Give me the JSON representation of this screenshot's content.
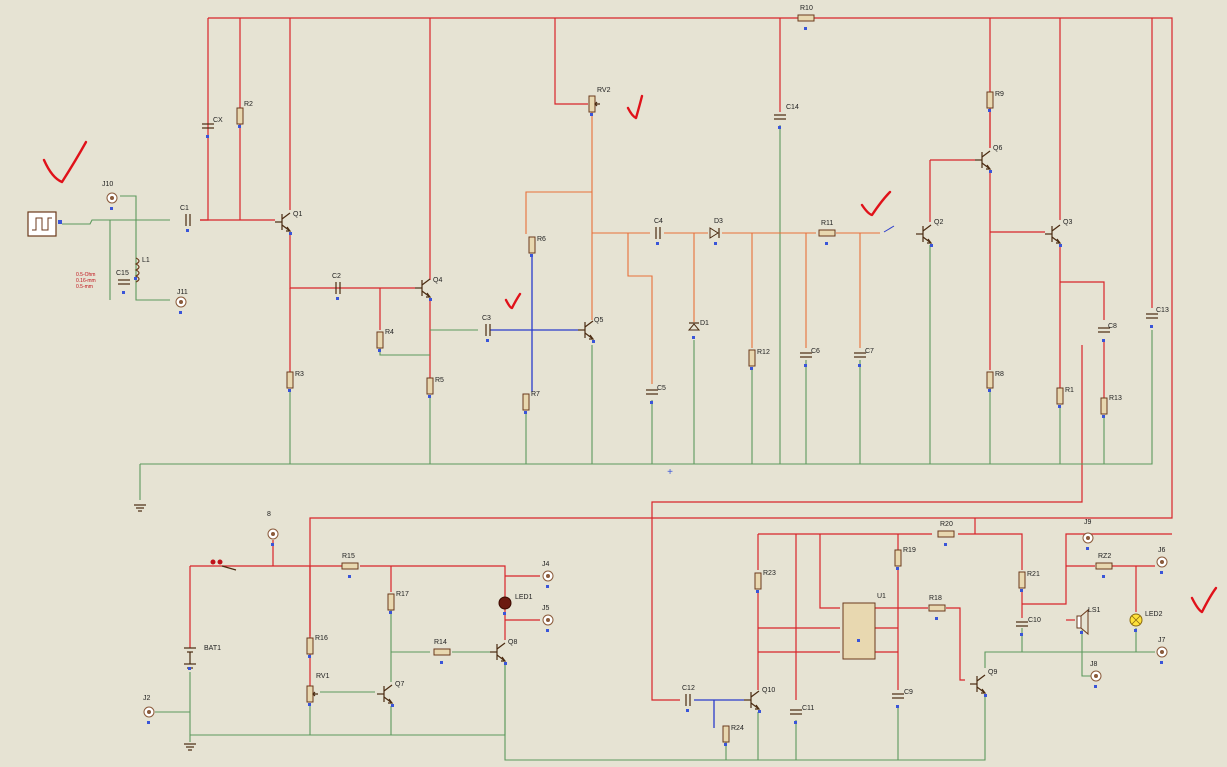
{
  "components": [
    {
      "id": "x1",
      "ref": "J10",
      "type": "pin"
    },
    {
      "id": "x2",
      "ref": "J11",
      "type": "pin"
    },
    {
      "id": "x3",
      "ref": "C1",
      "type": "cap"
    },
    {
      "id": "x4",
      "ref": "L1",
      "type": "ind"
    },
    {
      "id": "x5",
      "ref": "C15",
      "type": "cap"
    },
    {
      "id": "x6",
      "ref": "R2",
      "type": "res"
    },
    {
      "id": "x7",
      "ref": "CX",
      "type": "cap"
    },
    {
      "id": "x8",
      "ref": "Q1",
      "type": "npn"
    },
    {
      "id": "x9",
      "ref": "C2",
      "type": "cap"
    },
    {
      "id": "x10",
      "ref": "Q4",
      "type": "npn"
    },
    {
      "id": "x11",
      "ref": "R4",
      "type": "res"
    },
    {
      "id": "x12",
      "ref": "R3",
      "type": "res"
    },
    {
      "id": "x13",
      "ref": "R5",
      "type": "res"
    },
    {
      "id": "x14",
      "ref": "C3",
      "type": "cap"
    },
    {
      "id": "x15",
      "ref": "R6",
      "type": "res"
    },
    {
      "id": "x16",
      "ref": "R7",
      "type": "res"
    },
    {
      "id": "x17",
      "ref": "Q5",
      "type": "npn"
    },
    {
      "id": "x18",
      "ref": "RV2",
      "type": "pot"
    },
    {
      "id": "x19",
      "ref": "C4",
      "type": "cap"
    },
    {
      "id": "x20",
      "ref": "D3",
      "type": "diode"
    },
    {
      "id": "x21",
      "ref": "D1",
      "type": "diode"
    },
    {
      "id": "x22",
      "ref": "C5",
      "type": "cap"
    },
    {
      "id": "x23",
      "ref": "R12",
      "type": "res"
    },
    {
      "id": "x24",
      "ref": "C6",
      "type": "cap"
    },
    {
      "id": "x25",
      "ref": "C7",
      "type": "cap"
    },
    {
      "id": "x26",
      "ref": "R11",
      "type": "res"
    },
    {
      "id": "x27",
      "ref": "C14",
      "type": "cap"
    },
    {
      "id": "x28",
      "ref": "R10",
      "type": "res"
    },
    {
      "id": "x29",
      "ref": "Q2",
      "type": "npn"
    },
    {
      "id": "x30",
      "ref": "R9",
      "type": "res"
    },
    {
      "id": "x31",
      "ref": "Q6",
      "type": "npn"
    },
    {
      "id": "x32",
      "ref": "R8",
      "type": "res"
    },
    {
      "id": "x33",
      "ref": "Q3",
      "type": "npn"
    },
    {
      "id": "x34",
      "ref": "R1",
      "type": "res"
    },
    {
      "id": "x35",
      "ref": "C8",
      "type": "cap"
    },
    {
      "id": "x36",
      "ref": "R13",
      "type": "res"
    },
    {
      "id": "x37",
      "ref": "C13",
      "type": "cap"
    },
    {
      "id": "x38",
      "ref": "8",
      "type": "pin"
    },
    {
      "id": "x39",
      "ref": "R15",
      "type": "res"
    },
    {
      "id": "x40",
      "ref": "BAT1",
      "type": "battery"
    },
    {
      "id": "x41",
      "ref": "J2",
      "type": "pin"
    },
    {
      "id": "x42",
      "ref": "R16",
      "type": "res"
    },
    {
      "id": "x43",
      "ref": "RV1",
      "type": "pot"
    },
    {
      "id": "x44",
      "ref": "R17",
      "type": "res"
    },
    {
      "id": "x45",
      "ref": "Q7",
      "type": "npn"
    },
    {
      "id": "x46",
      "ref": "R14",
      "type": "res"
    },
    {
      "id": "x47",
      "ref": "Q8",
      "type": "npn"
    },
    {
      "id": "x48",
      "ref": "LED1",
      "type": "led"
    },
    {
      "id": "x49",
      "ref": "J4",
      "type": "pin"
    },
    {
      "id": "x50",
      "ref": "J5",
      "type": "pin"
    },
    {
      "id": "x51",
      "ref": "R23",
      "type": "res"
    },
    {
      "id": "x52",
      "ref": "C12",
      "type": "cap"
    },
    {
      "id": "x53",
      "ref": "Q10",
      "type": "npn"
    },
    {
      "id": "x54",
      "ref": "R24",
      "type": "res"
    },
    {
      "id": "x55",
      "ref": "C11",
      "type": "cap"
    },
    {
      "id": "x56",
      "ref": "U1",
      "type": "ic"
    },
    {
      "id": "x57",
      "ref": "R19",
      "type": "res"
    },
    {
      "id": "x58",
      "ref": "C9",
      "type": "cap"
    },
    {
      "id": "x59",
      "ref": "R18",
      "type": "res"
    },
    {
      "id": "x60",
      "ref": "R20",
      "type": "res"
    },
    {
      "id": "x61",
      "ref": "Q9",
      "type": "npn"
    },
    {
      "id": "x62",
      "ref": "R21",
      "type": "res"
    },
    {
      "id": "x63",
      "ref": "C10",
      "type": "cap"
    },
    {
      "id": "x64",
      "ref": "J9",
      "type": "pin"
    },
    {
      "id": "x65",
      "ref": "RZ2",
      "type": "res"
    },
    {
      "id": "x66",
      "ref": "J6",
      "type": "pin"
    },
    {
      "id": "x67",
      "ref": "LS1",
      "type": "buzzer"
    },
    {
      "id": "x68",
      "ref": "LED2",
      "type": "led"
    },
    {
      "id": "x69",
      "ref": "J7",
      "type": "pin"
    },
    {
      "id": "x70",
      "ref": "J8",
      "type": "pin"
    }
  ],
  "coil_notes": [
    "0.5-Ohm",
    "0.16-mm",
    "0.5-mm"
  ],
  "plus_mark": "+"
}
